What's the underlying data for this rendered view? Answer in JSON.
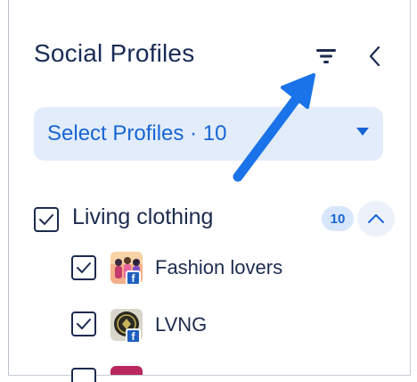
{
  "panel": {
    "title": "Social Profiles",
    "filter_icon": "filter-icon",
    "collapse_icon": "chevron-left-icon"
  },
  "select": {
    "label": "Select Profiles · 10",
    "caret_icon": "caret-down-icon"
  },
  "annotation": {
    "icon": "arrow-pointer-icon",
    "color": "#1a73e8"
  },
  "group": {
    "label": "Living clothing",
    "count": "10",
    "checked": true,
    "expand_icon": "chevron-up-icon"
  },
  "profiles": [
    {
      "label": "Fashion lovers",
      "checked": true,
      "network": "facebook",
      "network_glyph": "f"
    },
    {
      "label": "LVNG",
      "checked": true,
      "network": "facebook",
      "network_glyph": "f"
    },
    {
      "label": "",
      "checked": false,
      "network": "",
      "network_glyph": ""
    }
  ],
  "colors": {
    "accent": "#1766d4",
    "text": "#1d2b4f",
    "select_bg": "#e2ecfa",
    "badge_bg": "#d7e6fb"
  }
}
